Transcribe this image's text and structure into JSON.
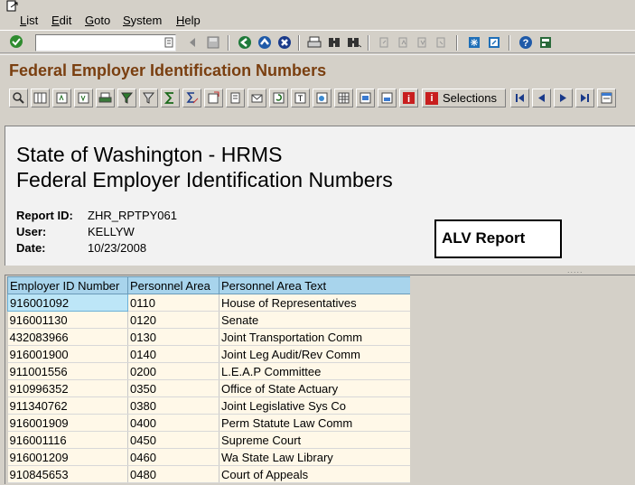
{
  "menubar": {
    "items": [
      {
        "label": "List"
      },
      {
        "label": "Edit"
      },
      {
        "label": "Goto"
      },
      {
        "label": "System"
      },
      {
        "label": "Help"
      }
    ]
  },
  "sysbar": {
    "command_value": ""
  },
  "title": "Federal Employer Identification Numbers",
  "apptoolbar": {
    "selections_label": "Selections"
  },
  "header": {
    "line1": "State of Washington - HRMS",
    "line2": "Federal Employer Identification Numbers",
    "report_id_label": "Report ID:",
    "report_id_value": "ZHR_RPTPY061",
    "user_label": "User:",
    "user_value": "KELLYW",
    "date_label": "Date:",
    "date_value": "10/23/2008",
    "alv_label": "ALV Report"
  },
  "grid": {
    "columns": [
      "Employer ID Number",
      "Personnel Area",
      "Personnel Area Text"
    ],
    "rows": [
      [
        "916001092",
        "0110",
        "House of Representatives"
      ],
      [
        "916001130",
        "0120",
        "Senate"
      ],
      [
        "432083966",
        "0130",
        "Joint Transportation Comm"
      ],
      [
        "916001900",
        "0140",
        "Joint Leg Audit/Rev Comm"
      ],
      [
        "911001556",
        "0200",
        "L.E.A.P Committee"
      ],
      [
        "910996352",
        "0350",
        "Office of State Actuary"
      ],
      [
        "911340762",
        "0380",
        "Joint Legislative Sys Co"
      ],
      [
        "916001909",
        "0400",
        "Perm Statute Law Comm"
      ],
      [
        "916001116",
        "0450",
        "Supreme Court"
      ],
      [
        "916001209",
        "0460",
        "Wa State Law Library"
      ],
      [
        "910845653",
        "0480",
        "Court of Appeals"
      ]
    ]
  },
  "colors": {
    "title": "#7a3f10",
    "header_cell": "#a8d4ec",
    "row_bg": "#fff8e8",
    "selected_cell": "#bde6f7"
  }
}
